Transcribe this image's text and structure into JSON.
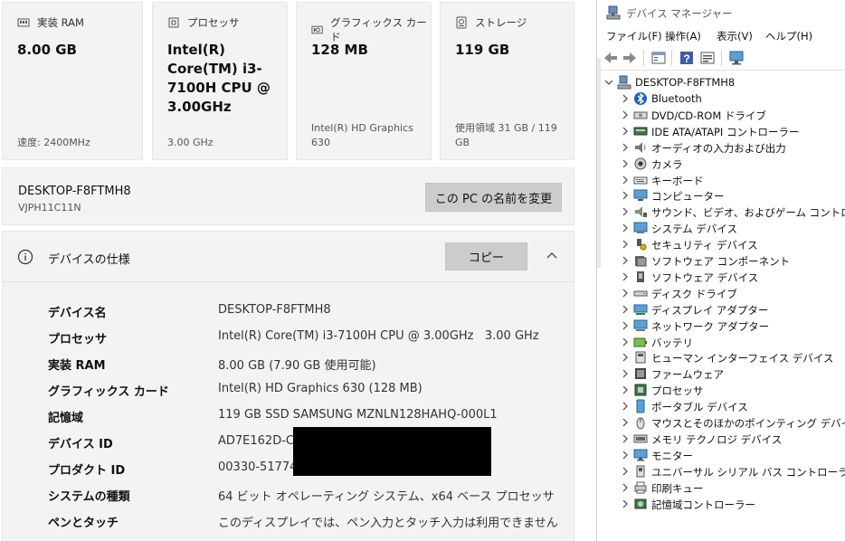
{
  "cards": [
    {
      "title": "実装 RAM",
      "value": "8.00 GB",
      "sub": "速度: 2400MHz",
      "icon": "ram-icon"
    },
    {
      "title": "プロセッサ",
      "value": "Intel(R) Core(TM) i3-7100H CPU @ 3.00GHz",
      "sub": "3.00 GHz",
      "icon": "processor-icon"
    },
    {
      "title": "グラフィックス カード",
      "value": "128 MB",
      "sub": "Intel(R) HD Graphics 630",
      "icon": "graphics-card-icon"
    },
    {
      "title": "ストレージ",
      "value": "119 GB",
      "sub": "使用領域 31 GB / 119 GB",
      "icon": "storage-icon"
    }
  ],
  "pc": {
    "name": "DESKTOP-F8FTMH8",
    "model": "VJPH11C11N",
    "rename_label": "この PC の名前を変更"
  },
  "specs": {
    "title": "デバイスの仕様",
    "copy_label": "コピー",
    "rows": [
      {
        "label": "デバイス名",
        "value": "DESKTOP-F8FTMH8"
      },
      {
        "label": "プロセッサ",
        "value": "Intel(R) Core(TM) i3-7100H CPU @ 3.00GHz   3.00 GHz"
      },
      {
        "label": "実装 RAM",
        "value": "8.00 GB (7.90 GB 使用可能)"
      },
      {
        "label": "グラフィックス カード",
        "value": "Intel(R) HD Graphics 630 (128 MB)"
      },
      {
        "label": "記憶域",
        "value": "119 GB SSD SAMSUNG MZNLN128HAHQ-000L1"
      },
      {
        "label": "デバイス ID",
        "value": "AD7E162D-C8"
      },
      {
        "label": "プロダクト ID",
        "value": "00330-51774-"
      },
      {
        "label": "システムの種類",
        "value": "64 ビット オペレーティング システム、x64 ベース プロセッサ"
      },
      {
        "label": "ペンとタッチ",
        "value": "このディスプレイでは、ペン入力とタッチ入力は利用できません"
      }
    ]
  },
  "device_manager": {
    "title": "デバイス マネージャー",
    "menu": [
      "ファイル(F)",
      "操作(A)",
      "表示(V)",
      "ヘルプ(H)"
    ],
    "root": "DESKTOP-F8FTMH8",
    "items": [
      {
        "label": "Bluetooth",
        "icon": "bluetooth-icon"
      },
      {
        "label": "DVD/CD-ROM ドライブ",
        "icon": "dvd-drive-icon"
      },
      {
        "label": "IDE ATA/ATAPI コントローラー",
        "icon": "ide-controller-icon"
      },
      {
        "label": "オーディオの入力および出力",
        "icon": "speaker-icon"
      },
      {
        "label": "カメラ",
        "icon": "camera-icon"
      },
      {
        "label": "キーボード",
        "icon": "keyboard-icon"
      },
      {
        "label": "コンピューター",
        "icon": "computer-icon"
      },
      {
        "label": "サウンド、ビデオ、およびゲーム コントローラー",
        "icon": "sound-icon"
      },
      {
        "label": "システム デバイス",
        "icon": "system-device-icon"
      },
      {
        "label": "セキュリティ デバイス",
        "icon": "security-key-icon"
      },
      {
        "label": "ソフトウェア コンポーネント",
        "icon": "software-component-icon"
      },
      {
        "label": "ソフトウェア デバイス",
        "icon": "software-device-icon"
      },
      {
        "label": "ディスク ドライブ",
        "icon": "disk-drive-icon"
      },
      {
        "label": "ディスプレイ アダプター",
        "icon": "display-adapter-icon"
      },
      {
        "label": "ネットワーク アダプター",
        "icon": "network-adapter-icon"
      },
      {
        "label": "バッテリ",
        "icon": "battery-icon"
      },
      {
        "label": "ヒューマン インターフェイス デバイス",
        "icon": "hid-icon"
      },
      {
        "label": "ファームウェア",
        "icon": "firmware-icon"
      },
      {
        "label": "プロセッサ",
        "icon": "processor-chip-icon"
      },
      {
        "label": "ポータブル デバイス",
        "icon": "portable-device-icon"
      },
      {
        "label": "マウスとそのほかのポインティング デバイス",
        "icon": "mouse-icon"
      },
      {
        "label": "メモリ テクノロジ デバイス",
        "icon": "memory-tech-icon"
      },
      {
        "label": "モニター",
        "icon": "monitor-icon"
      },
      {
        "label": "ユニバーサル シリアル バス コントローラー",
        "icon": "usb-icon"
      },
      {
        "label": "印刷キュー",
        "icon": "printer-icon"
      },
      {
        "label": "記憶域コントローラー",
        "icon": "storage-controller-icon"
      }
    ]
  }
}
